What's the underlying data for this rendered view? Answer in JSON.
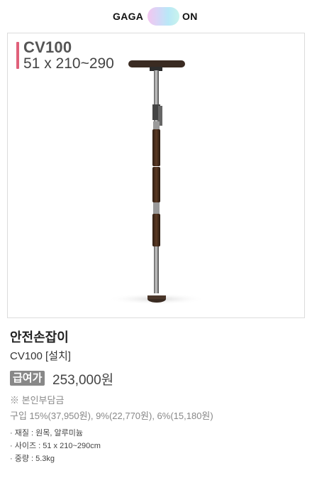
{
  "brand": {
    "left": "GAGA",
    "right": "ON"
  },
  "image_overlay": {
    "model_code": "CV100",
    "dimensions": "51 x 210~290"
  },
  "product": {
    "name": "안전손잡이",
    "model_option": "CV100 [설치]",
    "price_badge": "급여가",
    "price": "253,000원",
    "copay_title": "※ 본인부담금",
    "copay_detail": "구입 15%(37,950원), 9%(22,770원), 6%(15,180원)",
    "specs": [
      "· 재질 : 원목, 알루미늄",
      "· 사이즈 : 51 x 210~290cm",
      "· 중량 : 5.3kg"
    ]
  },
  "colors": {
    "accent_bar": "#e0607a",
    "badge_bg": "#888888"
  }
}
